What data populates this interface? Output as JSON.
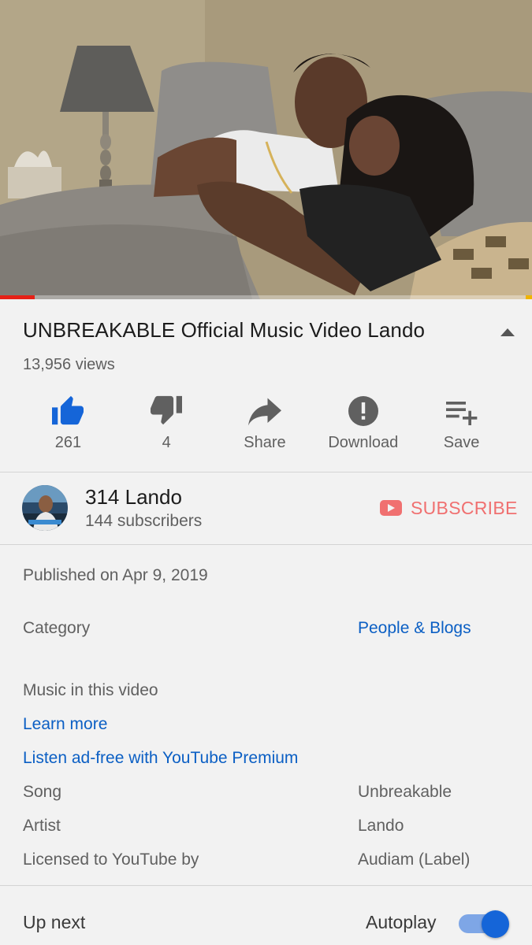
{
  "video": {
    "title": "UNBREAKABLE Official Music Video Lando",
    "views": "13,956 views",
    "progress": 0.065
  },
  "actions": {
    "like": {
      "label": "261",
      "icon": "thumbs-up-icon",
      "active": true
    },
    "dislike": {
      "label": "4",
      "icon": "thumbs-down-icon"
    },
    "share": {
      "label": "Share",
      "icon": "share-arrow-icon"
    },
    "download": {
      "label": "Download",
      "icon": "alert-circle-icon"
    },
    "save": {
      "label": "Save",
      "icon": "playlist-add-icon"
    }
  },
  "channel": {
    "name": "314 Lando",
    "subscribers": "144 subscribers",
    "subscribe_label": "SUBSCRIBE"
  },
  "details": {
    "published": "Published on Apr 9, 2019",
    "category_label": "Category",
    "category_value": "People & Blogs",
    "music_heading": "Music in this video",
    "learn_more": "Learn more",
    "premium": "Listen ad-free with YouTube Premium",
    "song_label": "Song",
    "song_value": "Unbreakable",
    "artist_label": "Artist",
    "artist_value": "Lando",
    "licensed_label": "Licensed to YouTube by",
    "licensed_value": "Audiam (Label)"
  },
  "up_next": {
    "label": "Up next",
    "autoplay_label": "Autoplay",
    "autoplay_on": true
  },
  "colors": {
    "accent_blue": "#0b5fc4",
    "like_blue": "#1565d8",
    "subscribe_red": "#f07070",
    "progress_red": "#e62117"
  }
}
